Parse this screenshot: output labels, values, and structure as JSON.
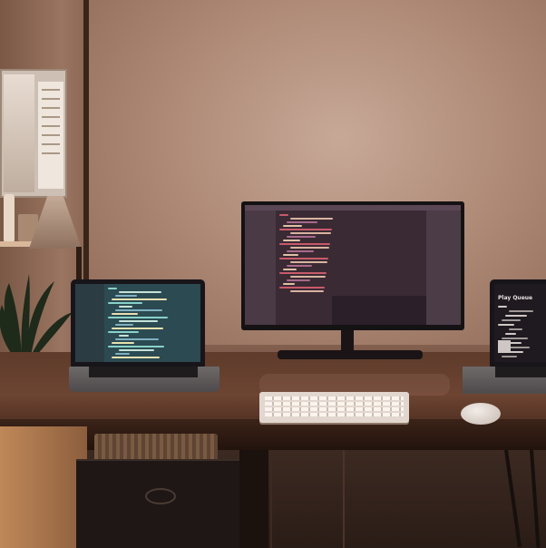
{
  "scene": {
    "description_tag": "desk-setup-photo",
    "right_laptop": {
      "screen_title": "Play Queue"
    }
  },
  "palette": {
    "wall": "#b08c79",
    "desk": "#5e3b2b",
    "monitor_screen": "#3a2a34",
    "left_laptop_screen": "#2c4a52",
    "keyboard": "#e2d7cf"
  }
}
